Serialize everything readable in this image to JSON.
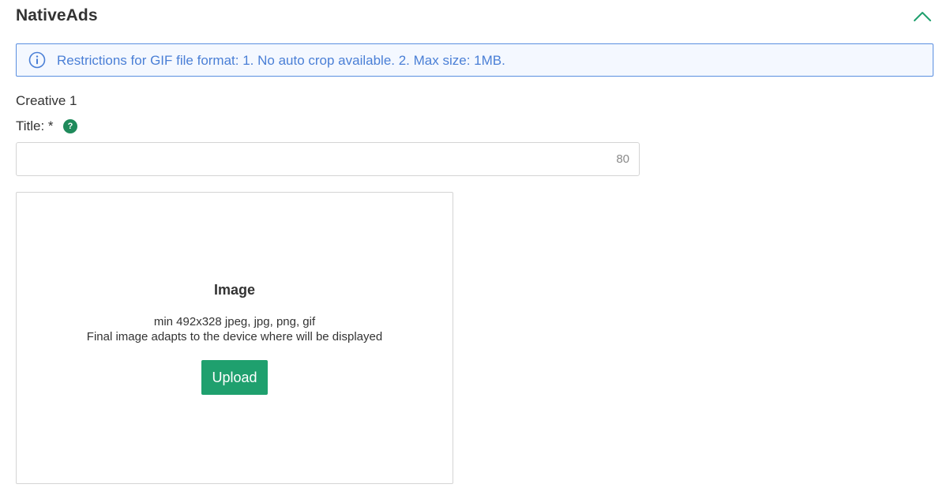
{
  "section": {
    "title": "NativeAds",
    "toggle_icon": "chevron-up-icon"
  },
  "alert": {
    "icon": "info-icon",
    "text": "Restrictions for GIF file format: 1. No auto crop available. 2. Max size: 1MB.",
    "border_color": "#5b8fe0",
    "text_color": "#4a7fd6"
  },
  "creative": {
    "label": "Creative 1",
    "title_field": {
      "label": "Title: *",
      "help_glyph": "?",
      "value": "",
      "placeholder": "",
      "counter": "80"
    },
    "image_upload": {
      "heading": "Image",
      "hint_formats": "min 492x328 jpeg, jpg, png, gif",
      "hint_adapt": "Final image adapts to the device where will be displayed",
      "button_label": "Upload"
    }
  },
  "colors": {
    "accent_green": "#1fa06e",
    "help_green": "#1f8a5b"
  }
}
